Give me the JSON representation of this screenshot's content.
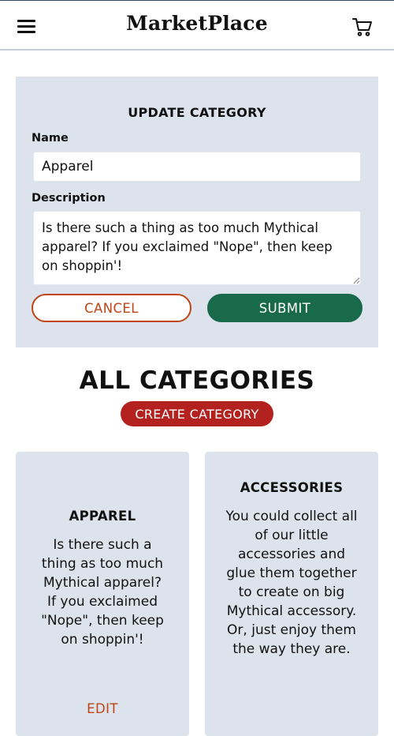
{
  "header": {
    "brand": "MarketPlace",
    "menu_icon": "hamburger-menu-icon",
    "cart_icon": "shopping-cart-icon"
  },
  "form": {
    "title": "UPDATE CATEGORY",
    "name_label": "Name",
    "name_value": "Apparel",
    "description_label": "Description",
    "description_value": "Is there such a thing as too much Mythical apparel? If you exclaimed \"Nope\", then keep on shoppin'!",
    "cancel_label": "CANCEL",
    "submit_label": "SUBMIT"
  },
  "categories_section": {
    "title": "ALL CATEGORIES",
    "create_label": "CREATE CATEGORY",
    "items": [
      {
        "name": "APPAREL",
        "description": "Is there such a thing as too much Mythical apparel? If you exclaimed \"Nope\", then keep on shoppin'!",
        "edit_label": "EDIT"
      },
      {
        "name": "ACCESSORIES",
        "description": "You could collect all of our little accessories and glue them together to create on big Mythical accessory. Or, just enjoy them the way they are."
      }
    ]
  },
  "colors": {
    "card_bg": "#dde3ec",
    "cancel_accent": "#c14416",
    "submit_bg": "#19694b",
    "create_bg": "#b3221f"
  }
}
